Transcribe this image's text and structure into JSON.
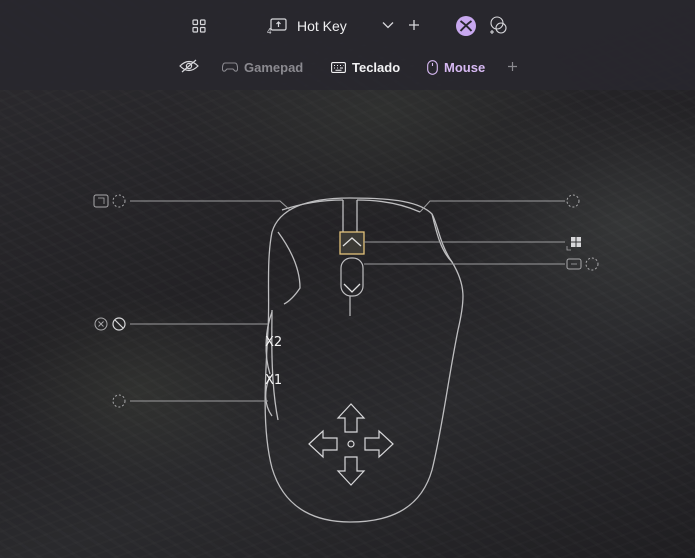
{
  "toolbar": {
    "profile_name": "Hot Key",
    "profile_number": "4"
  },
  "tabs": [
    {
      "label": "Gamepad",
      "state": "inactive"
    },
    {
      "label": "Teclado",
      "state": "normal"
    },
    {
      "label": "Mouse",
      "state": "active"
    }
  ],
  "mouse": {
    "side_button_top": "X2",
    "side_button_bottom": "X1"
  },
  "colors": {
    "accent": "#d7b9f3",
    "highlight": "#e3c27a",
    "xbox_purple": "#b996ea",
    "panel": "#28272e"
  },
  "icons": [
    "grid-icon",
    "profile-icon",
    "chevron-down-icon",
    "plus-icon",
    "xbox-icon",
    "add-controller-icon",
    "eye-off-icon",
    "gamepad-icon",
    "keyboard-icon",
    "mouse-icon",
    "windows-icon",
    "no-entry-icon"
  ]
}
